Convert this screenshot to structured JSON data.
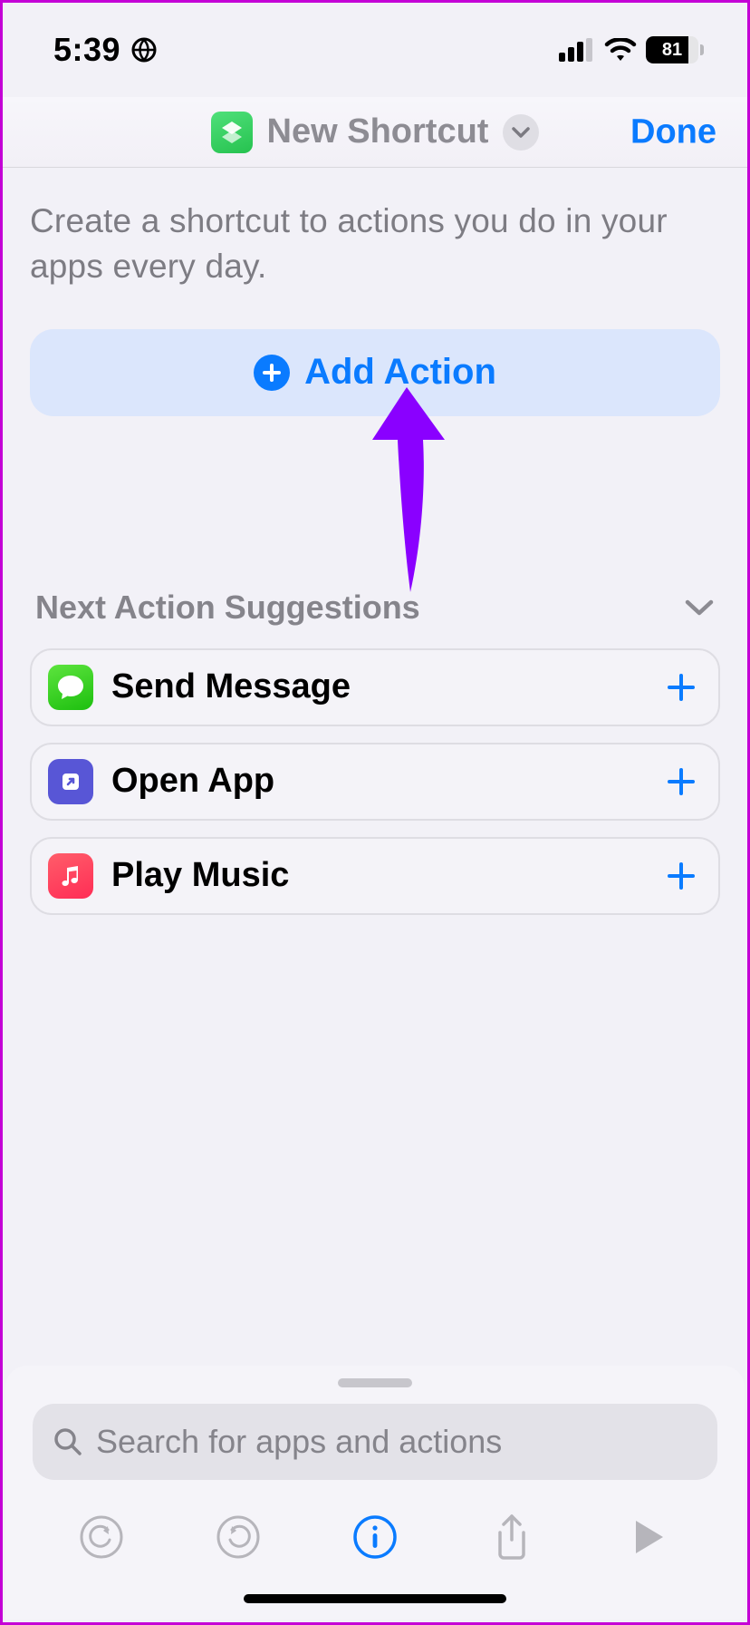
{
  "status": {
    "time": "5:39",
    "battery_percent": "81",
    "battery_fill_pct": 81
  },
  "nav": {
    "title": "New Shortcut",
    "done_label": "Done"
  },
  "intro_text": "Create a shortcut to actions you do in your apps every day.",
  "add_action_label": "Add Action",
  "suggestions_header": "Next Action Suggestions",
  "suggestions": [
    {
      "label": "Send Message",
      "icon": "messages-app-icon"
    },
    {
      "label": "Open App",
      "icon": "shortcuts-app-icon"
    },
    {
      "label": "Play Music",
      "icon": "music-app-icon"
    }
  ],
  "search": {
    "placeholder": "Search for apps and actions"
  },
  "colors": {
    "accent_blue": "#0a7bff",
    "annotation_purple": "#8a00ff"
  }
}
